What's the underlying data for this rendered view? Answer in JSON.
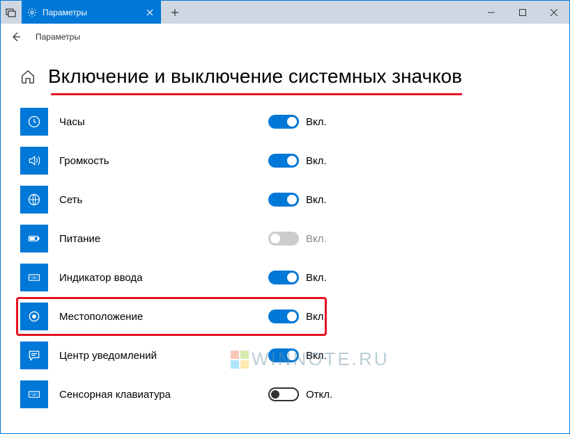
{
  "window": {
    "tab_title": "Параметры",
    "breadcrumb": "Параметры"
  },
  "page": {
    "heading": "Включение и выключение системных значков"
  },
  "toggle_states": {
    "on": "Вкл.",
    "off": "Откл."
  },
  "settings": [
    {
      "key": "clock",
      "label": "Часы",
      "state": "on",
      "state_label": "Вкл."
    },
    {
      "key": "volume",
      "label": "Громкость",
      "state": "on",
      "state_label": "Вкл."
    },
    {
      "key": "network",
      "label": "Сеть",
      "state": "on",
      "state_label": "Вкл."
    },
    {
      "key": "power",
      "label": "Питание",
      "state": "off-disabled",
      "state_label": "Вкл."
    },
    {
      "key": "input",
      "label": "Индикатор ввода",
      "state": "on",
      "state_label": "Вкл."
    },
    {
      "key": "location",
      "label": "Местоположение",
      "state": "on",
      "state_label": "Вкл."
    },
    {
      "key": "action",
      "label": "Центр уведомлений",
      "state": "on",
      "state_label": "Вкл."
    },
    {
      "key": "touchkeyboard",
      "label": "Сенсорная клавиатура",
      "state": "off-outline",
      "state_label": "Откл."
    }
  ],
  "watermark": "WINNOTE.RU"
}
